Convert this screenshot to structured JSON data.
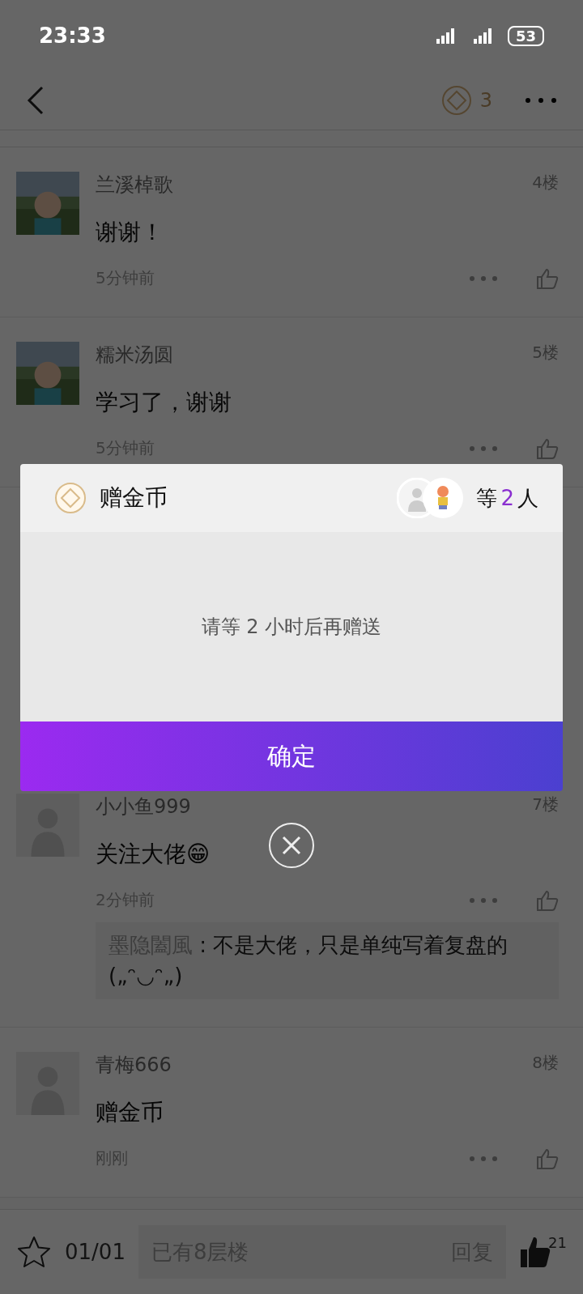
{
  "status_bar": {
    "time": "23:33",
    "battery": "53"
  },
  "nav": {
    "coins": "3"
  },
  "comments": [
    {
      "user": "兰溪棹歌",
      "floor": "4楼",
      "text": "谢谢！",
      "time": "5分钟前"
    },
    {
      "user": "糯米汤圆",
      "floor": "5楼",
      "text": "学习了，谢谢",
      "time": "5分钟前"
    },
    {
      "user": "小小鱼999",
      "floor": "7楼",
      "text": "关注大佬😁",
      "time": "2分钟前",
      "avatar": {
        "kind": "default"
      },
      "reply": {
        "user": "墨隐闔風",
        "text": ": 不是大佬，只是单纯写着复盘的(„ᵔ◡ᵔ„)"
      }
    },
    {
      "user": "青梅666",
      "floor": "8楼",
      "text": "赠金币",
      "time": "刚刚",
      "avatar": {
        "kind": "default"
      }
    }
  ],
  "dialog": {
    "title": "赠金币",
    "count_prefix": "等",
    "count": "2",
    "count_suffix": "人",
    "message": "请等 2 小时后再赠送",
    "confirm": "确定"
  },
  "bottom_bar": {
    "page": "01/01",
    "placeholder": "已有8层楼",
    "reply": "回复",
    "likes": "21"
  }
}
